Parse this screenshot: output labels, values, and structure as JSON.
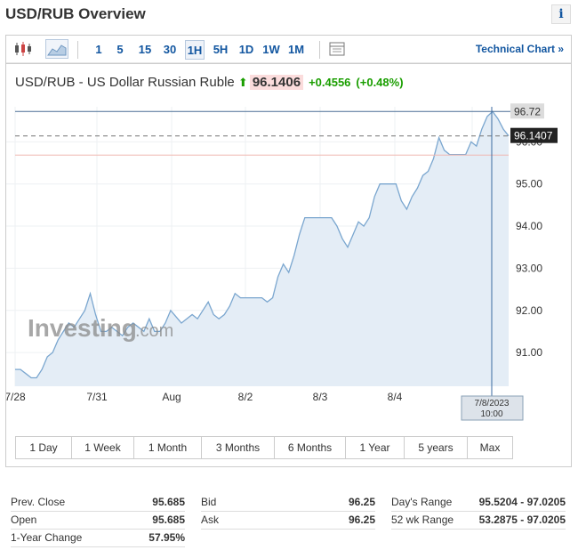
{
  "page": {
    "title": "USD/RUB Overview",
    "info_label": "i"
  },
  "toolbar": {
    "intervals": [
      "1",
      "5",
      "15",
      "30",
      "1H",
      "5H",
      "1D",
      "1W",
      "1M"
    ],
    "active_interval": "1H",
    "technical_chart": "Technical Chart »"
  },
  "quote": {
    "name": "USD/RUB - US Dollar Russian Ruble",
    "last": "96.1406",
    "change": "+0.4556",
    "change_pct": "(+0.48%)"
  },
  "chart": {
    "watermark_main": "Investing",
    "watermark_suffix": ".com",
    "high_label": "96.72",
    "current_label": "96.1407",
    "crosshair_label": [
      "7/8/2023",
      "10:00"
    ],
    "line_color": "#7aa6cf",
    "fill_color": "#e4edf6"
  },
  "chart_data": {
    "type": "area",
    "ylim": [
      90.2,
      97.0
    ],
    "y_ticks": [
      "91.00",
      "92.00",
      "93.00",
      "94.00",
      "95.00",
      "96.00"
    ],
    "x_labels": [
      "7/28",
      "7/31",
      "Aug",
      "8/2",
      "8/3",
      "8/4",
      "7/8"
    ],
    "values": [
      90.6,
      90.6,
      90.5,
      90.4,
      90.4,
      90.6,
      90.9,
      91.0,
      91.3,
      91.5,
      91.7,
      91.6,
      91.8,
      92.0,
      92.4,
      91.9,
      91.5,
      91.5,
      91.6,
      91.5,
      91.4,
      91.6,
      91.7,
      91.6,
      91.5,
      91.8,
      91.5,
      91.5,
      91.7,
      92.0,
      91.85,
      91.7,
      91.8,
      91.9,
      91.8,
      92.0,
      92.2,
      91.9,
      91.8,
      91.9,
      92.1,
      92.4,
      92.3,
      92.3,
      92.3,
      92.3,
      92.3,
      92.2,
      92.3,
      92.8,
      93.1,
      92.9,
      93.3,
      93.8,
      94.2,
      94.2,
      94.2,
      94.2,
      94.2,
      94.2,
      94.0,
      93.7,
      93.5,
      93.8,
      94.1,
      94.0,
      94.2,
      94.7,
      95.0,
      95.0,
      95.0,
      95.0,
      94.6,
      94.4,
      94.7,
      94.9,
      95.2,
      95.3,
      95.6,
      96.1,
      95.8,
      95.7,
      95.7,
      95.7,
      95.7,
      96.0,
      95.9,
      96.3,
      96.6,
      96.72,
      96.55,
      96.3,
      96.1406
    ],
    "high": 96.72,
    "current": 96.1407,
    "previous_close_line": 95.685
  },
  "ranges": [
    "1 Day",
    "1 Week",
    "1 Month",
    "3 Months",
    "6 Months",
    "1 Year",
    "5 years",
    "Max"
  ],
  "stats": {
    "col1": [
      {
        "label": "Prev. Close",
        "value": "95.685"
      },
      {
        "label": "Open",
        "value": "95.685"
      },
      {
        "label": "1-Year Change",
        "value": "57.95%"
      }
    ],
    "col2": [
      {
        "label": "Bid",
        "value": "96.25"
      },
      {
        "label": "Ask",
        "value": "96.25"
      }
    ],
    "col3": [
      {
        "label": "Day's Range",
        "value": "95.5204 - 97.0205"
      },
      {
        "label": "52 wk Range",
        "value": "53.2875 - 97.0205"
      }
    ]
  }
}
